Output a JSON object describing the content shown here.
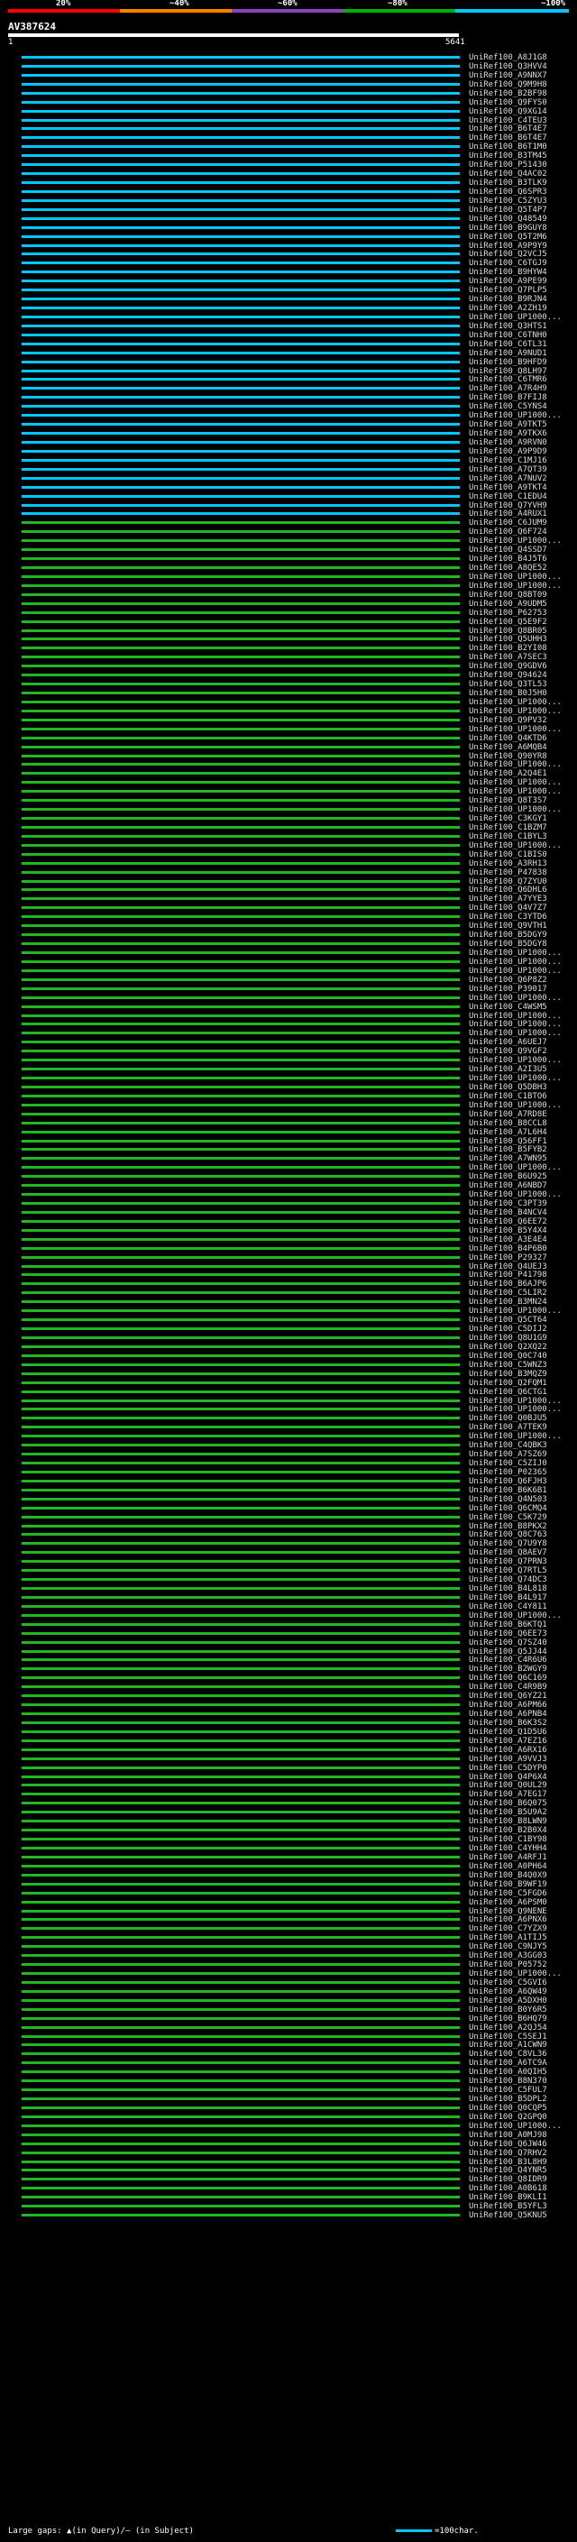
{
  "legend": {
    "labels": [
      "20%",
      "~40%",
      "~60%",
      "~80%",
      "~100%"
    ],
    "colors": [
      "#ff0000",
      "#ff8000",
      "#9040c0",
      "#00b000",
      "#00c8ff"
    ]
  },
  "query": {
    "title": "AV387624",
    "start": "1",
    "end": "5641"
  },
  "colors": {
    "cyan": "#00c8ff",
    "green": "#20b820",
    "white": "#ffffff"
  },
  "hits": [
    {
      "label": "UniRef100_A8J1G8",
      "c": "cyan"
    },
    {
      "label": "UniRef100_Q3HVV4",
      "c": "cyan"
    },
    {
      "label": "UniRef100_A9NNX7",
      "c": "cyan"
    },
    {
      "label": "UniRef100_Q9M9H8",
      "c": "cyan"
    },
    {
      "label": "UniRef100_B2BF98",
      "c": "cyan"
    },
    {
      "label": "UniRef100_Q9FYS0",
      "c": "cyan"
    },
    {
      "label": "UniRef100_Q9XG14",
      "c": "cyan"
    },
    {
      "label": "UniRef100_C4TEU3",
      "c": "cyan"
    },
    {
      "label": "UniRef100_B6T4E7",
      "c": "cyan"
    },
    {
      "label": "UniRef100_B6T4E7",
      "c": "cyan"
    },
    {
      "label": "UniRef100_B6T1M0",
      "c": "cyan"
    },
    {
      "label": "UniRef100_B3TM45",
      "c": "cyan"
    },
    {
      "label": "UniRef100_P51430",
      "c": "cyan"
    },
    {
      "label": "UniRef100_Q4AC02",
      "c": "cyan"
    },
    {
      "label": "UniRef100_B3TLK9",
      "c": "cyan"
    },
    {
      "label": "UniRef100_Q6SPR3",
      "c": "cyan"
    },
    {
      "label": "UniRef100_C5ZYU3",
      "c": "cyan"
    },
    {
      "label": "UniRef100_Q5T4P7",
      "c": "cyan"
    },
    {
      "label": "UniRef100_Q48549",
      "c": "cyan"
    },
    {
      "label": "UniRef100_B9GUY8",
      "c": "cyan"
    },
    {
      "label": "UniRef100_Q5T2M6",
      "c": "cyan"
    },
    {
      "label": "UniRef100_A9P9Y9",
      "c": "cyan"
    },
    {
      "label": "UniRef100_Q2VCJ5",
      "c": "cyan"
    },
    {
      "label": "UniRef100_C6TGJ9",
      "c": "cyan"
    },
    {
      "label": "UniRef100_B9HYW4",
      "c": "cyan"
    },
    {
      "label": "UniRef100_A9PE99",
      "c": "cyan"
    },
    {
      "label": "UniRef100_Q7PLP5",
      "c": "cyan"
    },
    {
      "label": "UniRef100_B9RJN4",
      "c": "cyan"
    },
    {
      "label": "UniRef100_A2ZH19",
      "c": "cyan"
    },
    {
      "label": "UniRef100_UP1000...",
      "c": "cyan"
    },
    {
      "label": "UniRef100_Q3HTS1",
      "c": "cyan"
    },
    {
      "label": "UniRef100_C6TNH0",
      "c": "cyan"
    },
    {
      "label": "UniRef100_C6TL31",
      "c": "cyan"
    },
    {
      "label": "UniRef100_A9NUD1",
      "c": "cyan"
    },
    {
      "label": "UniRef100_B9HFD9",
      "c": "cyan"
    },
    {
      "label": "UniRef100_Q8LH97",
      "c": "cyan"
    },
    {
      "label": "UniRef100_C6TMR6",
      "c": "cyan"
    },
    {
      "label": "UniRef100_A7R4H9",
      "c": "cyan"
    },
    {
      "label": "UniRef100_B7FIJ8",
      "c": "cyan"
    },
    {
      "label": "UniRef100_C5YNS4",
      "c": "cyan"
    },
    {
      "label": "UniRef100_UP1000...",
      "c": "cyan"
    },
    {
      "label": "UniRef100_A9TKT5",
      "c": "cyan"
    },
    {
      "label": "UniRef100_A9TKX6",
      "c": "cyan"
    },
    {
      "label": "UniRef100_A9RVN0",
      "c": "cyan"
    },
    {
      "label": "UniRef100_A9P9D9",
      "c": "cyan"
    },
    {
      "label": "UniRef100_C1MJ16",
      "c": "cyan"
    },
    {
      "label": "UniRef100_A7QT39",
      "c": "cyan"
    },
    {
      "label": "UniRef100_A7NUV2",
      "c": "cyan"
    },
    {
      "label": "UniRef100_A9TKT4",
      "c": "cyan"
    },
    {
      "label": "UniRef100_C1EDU4",
      "c": "cyan"
    },
    {
      "label": "UniRef100_Q7YVH9",
      "c": "cyan"
    },
    {
      "label": "UniRef100_A4RUX1",
      "c": "cyan"
    },
    {
      "label": "UniRef100_C6JUM9",
      "c": "green"
    },
    {
      "label": "UniRef100_Q6F724",
      "c": "green"
    },
    {
      "label": "UniRef100_UP1000...",
      "c": "green"
    },
    {
      "label": "UniRef100_Q4SSD7",
      "c": "green"
    },
    {
      "label": "UniRef100_B4J5T6",
      "c": "green"
    },
    {
      "label": "UniRef100_A8QE52",
      "c": "green"
    },
    {
      "label": "UniRef100_UP1000...",
      "c": "green"
    },
    {
      "label": "UniRef100_UP1000...",
      "c": "green"
    },
    {
      "label": "UniRef100_Q8BT09",
      "c": "green"
    },
    {
      "label": "UniRef100_A9UDM5",
      "c": "green"
    },
    {
      "label": "UniRef100_P62753",
      "c": "green"
    },
    {
      "label": "UniRef100_Q5E9F2",
      "c": "green"
    },
    {
      "label": "UniRef100_Q8BR05",
      "c": "green"
    },
    {
      "label": "UniRef100_Q5UHH3",
      "c": "green"
    },
    {
      "label": "UniRef100_B2YI08",
      "c": "green"
    },
    {
      "label": "UniRef100_A7SEC3",
      "c": "green"
    },
    {
      "label": "UniRef100_Q9GDV6",
      "c": "green"
    },
    {
      "label": "UniRef100_Q94624",
      "c": "green"
    },
    {
      "label": "UniRef100_Q3TL53",
      "c": "green"
    },
    {
      "label": "UniRef100_B0J5H0",
      "c": "green"
    },
    {
      "label": "UniRef100_UP1000...",
      "c": "green"
    },
    {
      "label": "UniRef100_UP1000...",
      "c": "green"
    },
    {
      "label": "UniRef100_Q9PV32",
      "c": "green"
    },
    {
      "label": "UniRef100_UP1000...",
      "c": "green"
    },
    {
      "label": "UniRef100_Q4KTD6",
      "c": "green"
    },
    {
      "label": "UniRef100_A6MQB4",
      "c": "green"
    },
    {
      "label": "UniRef100_Q90YR8",
      "c": "green"
    },
    {
      "label": "UniRef100_UP1000...",
      "c": "green"
    },
    {
      "label": "UniRef100_A2Q4E1",
      "c": "green"
    },
    {
      "label": "UniRef100_UP1000...",
      "c": "green"
    },
    {
      "label": "UniRef100_UP1000...",
      "c": "green"
    },
    {
      "label": "UniRef100_Q8T3S7",
      "c": "green"
    },
    {
      "label": "UniRef100_UP1000...",
      "c": "green"
    },
    {
      "label": "UniRef100_C3KGY1",
      "c": "green"
    },
    {
      "label": "UniRef100_C1BZM7",
      "c": "green"
    },
    {
      "label": "UniRef100_C1BYL3",
      "c": "green"
    },
    {
      "label": "UniRef100_UP1000...",
      "c": "green"
    },
    {
      "label": "UniRef100_C1BIS0",
      "c": "green"
    },
    {
      "label": "UniRef100_A3RH13",
      "c": "green"
    },
    {
      "label": "UniRef100_P47838",
      "c": "green"
    },
    {
      "label": "UniRef100_Q7ZYU0",
      "c": "green"
    },
    {
      "label": "UniRef100_Q6DHL6",
      "c": "green"
    },
    {
      "label": "UniRef100_A7YYE3",
      "c": "green"
    },
    {
      "label": "UniRef100_Q4V7Z7",
      "c": "green"
    },
    {
      "label": "UniRef100_C3YTD6",
      "c": "green"
    },
    {
      "label": "UniRef100_Q9VTH1",
      "c": "green"
    },
    {
      "label": "UniRef100_B5DGY9",
      "c": "green"
    },
    {
      "label": "UniRef100_B5DGY8",
      "c": "green"
    },
    {
      "label": "UniRef100_UP1000...",
      "c": "green"
    },
    {
      "label": "UniRef100_UP1000...",
      "c": "green"
    },
    {
      "label": "UniRef100_UP1000...",
      "c": "green"
    },
    {
      "label": "UniRef100_Q6P8Z2",
      "c": "green"
    },
    {
      "label": "UniRef100_P39017",
      "c": "green"
    },
    {
      "label": "UniRef100_UP1000...",
      "c": "green"
    },
    {
      "label": "UniRef100_C4WSM5",
      "c": "green"
    },
    {
      "label": "UniRef100_UP1000...",
      "c": "green"
    },
    {
      "label": "UniRef100_UP1000...",
      "c": "green"
    },
    {
      "label": "UniRef100_UP1000...",
      "c": "green"
    },
    {
      "label": "UniRef100_A6UEJ7",
      "c": "green"
    },
    {
      "label": "UniRef100_Q9VGF2",
      "c": "green"
    },
    {
      "label": "UniRef100_UP1000...",
      "c": "green"
    },
    {
      "label": "UniRef100_A2I3U5",
      "c": "green"
    },
    {
      "label": "UniRef100_UP1000...",
      "c": "green"
    },
    {
      "label": "UniRef100_Q5DBH3",
      "c": "green"
    },
    {
      "label": "UniRef100_C1BTO6",
      "c": "green"
    },
    {
      "label": "UniRef100_UP1000...",
      "c": "green"
    },
    {
      "label": "UniRef100_A7RD8E",
      "c": "green"
    },
    {
      "label": "UniRef100_B8CCL8",
      "c": "green"
    },
    {
      "label": "UniRef100_A7L6H4",
      "c": "green"
    },
    {
      "label": "UniRef100_Q56FF1",
      "c": "green"
    },
    {
      "label": "UniRef100_B5FYB2",
      "c": "green"
    },
    {
      "label": "UniRef100_A7WN95",
      "c": "green"
    },
    {
      "label": "UniRef100_UP1000...",
      "c": "green"
    },
    {
      "label": "UniRef100_B6U925",
      "c": "green"
    },
    {
      "label": "UniRef100_A6NBD7",
      "c": "green"
    },
    {
      "label": "UniRef100_UP1000...",
      "c": "green"
    },
    {
      "label": "UniRef100_C3PT39",
      "c": "green"
    },
    {
      "label": "UniRef100_B4NCV4",
      "c": "green"
    },
    {
      "label": "UniRef100_Q6EE72",
      "c": "green"
    },
    {
      "label": "UniRef100_B5Y4X4",
      "c": "green"
    },
    {
      "label": "UniRef100_A3E4E4",
      "c": "green"
    },
    {
      "label": "UniRef100_B4P6B0",
      "c": "green"
    },
    {
      "label": "UniRef100_P29327",
      "c": "green"
    },
    {
      "label": "UniRef100_Q4UEJ3",
      "c": "green"
    },
    {
      "label": "UniRef100_P41798",
      "c": "green"
    },
    {
      "label": "UniRef100_B6AJP6",
      "c": "green"
    },
    {
      "label": "UniRef100_C5LIR2",
      "c": "green"
    },
    {
      "label": "UniRef100_B3MN24",
      "c": "green"
    },
    {
      "label": "UniRef100_UP1000...",
      "c": "green"
    },
    {
      "label": "UniRef100_Q5CT64",
      "c": "green"
    },
    {
      "label": "UniRef100_C5DIJ2",
      "c": "green"
    },
    {
      "label": "UniRef100_Q8U1G9",
      "c": "green"
    },
    {
      "label": "UniRef100_Q2XQ22",
      "c": "green"
    },
    {
      "label": "UniRef100_Q0C740",
      "c": "green"
    },
    {
      "label": "UniRef100_C5WNZ3",
      "c": "green"
    },
    {
      "label": "UniRef100_B3MQZ9",
      "c": "green"
    },
    {
      "label": "UniRef100_Q2FQM1",
      "c": "green"
    },
    {
      "label": "UniRef100_Q6CTG1",
      "c": "green"
    },
    {
      "label": "UniRef100_UP1000...",
      "c": "green"
    },
    {
      "label": "UniRef100_UP1000...",
      "c": "green"
    },
    {
      "label": "UniRef100_Q0BJU5",
      "c": "green"
    },
    {
      "label": "UniRef100_A7TEK9",
      "c": "green"
    },
    {
      "label": "UniRef100_UP1000...",
      "c": "green"
    },
    {
      "label": "UniRef100_C4QBK3",
      "c": "green"
    },
    {
      "label": "UniRef100_A7SZ69",
      "c": "green"
    },
    {
      "label": "UniRef100_C5ZIJ0",
      "c": "green"
    },
    {
      "label": "UniRef100_P02365",
      "c": "green"
    },
    {
      "label": "UniRef100_Q6FJH3",
      "c": "green"
    },
    {
      "label": "UniRef100_B6K6B1",
      "c": "green"
    },
    {
      "label": "UniRef100_Q4N503",
      "c": "green"
    },
    {
      "label": "UniRef100_Q6CMQ4",
      "c": "green"
    },
    {
      "label": "UniRef100_C5K729",
      "c": "green"
    },
    {
      "label": "UniRef100_B8PKX2",
      "c": "green"
    },
    {
      "label": "UniRef100_Q8C763",
      "c": "green"
    },
    {
      "label": "UniRef100_Q7U9Y8",
      "c": "green"
    },
    {
      "label": "UniRef100_Q8AEV7",
      "c": "green"
    },
    {
      "label": "UniRef100_Q7PRN3",
      "c": "green"
    },
    {
      "label": "UniRef100_Q7RTL5",
      "c": "green"
    },
    {
      "label": "UniRef100_Q74DC3",
      "c": "green"
    },
    {
      "label": "UniRef100_B4L818",
      "c": "green"
    },
    {
      "label": "UniRef100_B4L917",
      "c": "green"
    },
    {
      "label": "UniRef100_C4Y811",
      "c": "green"
    },
    {
      "label": "UniRef100_UP1000...",
      "c": "green"
    },
    {
      "label": "UniRef100_B6KTQ1",
      "c": "green"
    },
    {
      "label": "UniRef100_Q6EE73",
      "c": "green"
    },
    {
      "label": "UniRef100_Q7SZ40",
      "c": "green"
    },
    {
      "label": "UniRef100_Q5JJ44",
      "c": "green"
    },
    {
      "label": "UniRef100_C4R6U6",
      "c": "green"
    },
    {
      "label": "UniRef100_B2WGY9",
      "c": "green"
    },
    {
      "label": "UniRef100_Q6C169",
      "c": "green"
    },
    {
      "label": "UniRef100_C4R9B9",
      "c": "green"
    },
    {
      "label": "UniRef100_Q6YZ21",
      "c": "green"
    },
    {
      "label": "UniRef100_A6PM66",
      "c": "green"
    },
    {
      "label": "UniRef100_A6PNB4",
      "c": "green"
    },
    {
      "label": "UniRef100_B6K3S2",
      "c": "green"
    },
    {
      "label": "UniRef100_Q1D5U6",
      "c": "green"
    },
    {
      "label": "UniRef100_A7EZ16",
      "c": "green"
    },
    {
      "label": "UniRef100_A6RX16",
      "c": "green"
    },
    {
      "label": "UniRef100_A9VVJ3",
      "c": "green"
    },
    {
      "label": "UniRef100_C5DYP0",
      "c": "green"
    },
    {
      "label": "UniRef100_Q4P6X4",
      "c": "green"
    },
    {
      "label": "UniRef100_Q0UL29",
      "c": "green"
    },
    {
      "label": "UniRef100_A7EG17",
      "c": "green"
    },
    {
      "label": "UniRef100_B6Q075",
      "c": "green"
    },
    {
      "label": "UniRef100_B5U9A2",
      "c": "green"
    },
    {
      "label": "UniRef100_B8LWN9",
      "c": "green"
    },
    {
      "label": "UniRef100_B2B0X4",
      "c": "green"
    },
    {
      "label": "UniRef100_C1BY98",
      "c": "green"
    },
    {
      "label": "UniRef100_C4YHH4",
      "c": "green"
    },
    {
      "label": "UniRef100_A4RFJ1",
      "c": "green"
    },
    {
      "label": "UniRef100_A0PH64",
      "c": "green"
    },
    {
      "label": "UniRef100_B4Q0X9",
      "c": "green"
    },
    {
      "label": "UniRef100_B9WF19",
      "c": "green"
    },
    {
      "label": "UniRef100_C5FGD6",
      "c": "green"
    },
    {
      "label": "UniRef100_A6PSM0",
      "c": "green"
    },
    {
      "label": "UniRef100_Q9NENE",
      "c": "green"
    },
    {
      "label": "UniRef100_A6PNX6",
      "c": "green"
    },
    {
      "label": "UniRef100_C7YZX9",
      "c": "green"
    },
    {
      "label": "UniRef100_A1TIJ5",
      "c": "green"
    },
    {
      "label": "UniRef100_C9NJY5",
      "c": "green"
    },
    {
      "label": "UniRef100_A3GG03",
      "c": "green"
    },
    {
      "label": "UniRef100_P05752",
      "c": "green"
    },
    {
      "label": "UniRef100_UP1000...",
      "c": "green"
    },
    {
      "label": "UniRef100_C5GVI6",
      "c": "green"
    },
    {
      "label": "UniRef100_A6QW49",
      "c": "green"
    },
    {
      "label": "UniRef100_A5DXH0",
      "c": "green"
    },
    {
      "label": "UniRef100_B0Y6R5",
      "c": "green"
    },
    {
      "label": "UniRef100_B6HQ79",
      "c": "green"
    },
    {
      "label": "UniRef100_A2QJ54",
      "c": "green"
    },
    {
      "label": "UniRef100_C5SEJ1",
      "c": "green"
    },
    {
      "label": "UniRef100_A1CWN9",
      "c": "green"
    },
    {
      "label": "UniRef100_C8VL36",
      "c": "green"
    },
    {
      "label": "UniRef100_A6TC9A",
      "c": "green"
    },
    {
      "label": "UniRef100_A0QIH5",
      "c": "green"
    },
    {
      "label": "UniRef100_B8N370",
      "c": "green"
    },
    {
      "label": "UniRef100_C5FUL7",
      "c": "green"
    },
    {
      "label": "UniRef100_B5DPL2",
      "c": "green"
    },
    {
      "label": "UniRef100_Q0CQP5",
      "c": "green"
    },
    {
      "label": "UniRef100_Q2GPQ0",
      "c": "green"
    },
    {
      "label": "UniRef100_UP1000...",
      "c": "green"
    },
    {
      "label": "UniRef100_A0MJ98",
      "c": "green"
    },
    {
      "label": "UniRef100_Q6JW46",
      "c": "green"
    },
    {
      "label": "UniRef100_Q7RHV2",
      "c": "green"
    },
    {
      "label": "UniRef100_B3L8H9",
      "c": "green"
    },
    {
      "label": "UniRef100_Q4YNR5",
      "c": "green"
    },
    {
      "label": "UniRef100_Q8IDR9",
      "c": "green"
    },
    {
      "label": "UniRef100_A0B618",
      "c": "green"
    },
    {
      "label": "UniRef100_B9KLI1",
      "c": "green"
    },
    {
      "label": "UniRef100_B5YFL3",
      "c": "green"
    },
    {
      "label": "UniRef100_Q5KNU5",
      "c": "green"
    }
  ],
  "footer": {
    "left": "Large gaps: ▲(in Query)/– (in Subject)",
    "right": "=100char."
  }
}
